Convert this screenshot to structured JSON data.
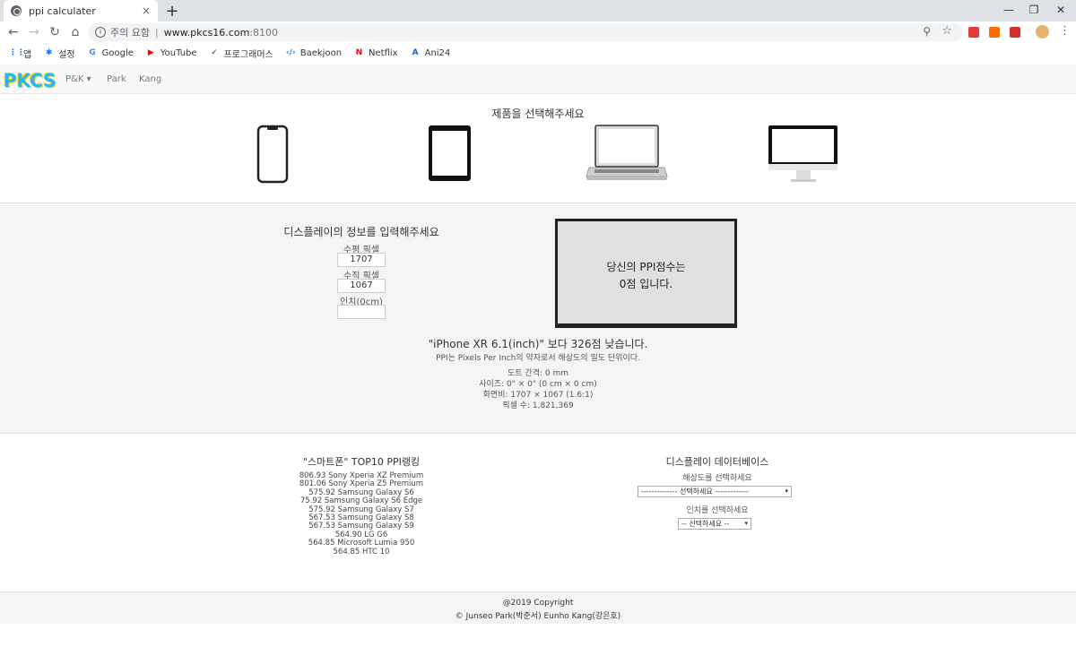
{
  "browser": {
    "tab_title": "ppi calculater",
    "tab_close": "×",
    "new_tab": "+",
    "win_min": "—",
    "win_restore": "❐",
    "win_close": "✕",
    "nav_back": "←",
    "nav_forward": "→",
    "nav_reload": "↻",
    "nav_home": "⌂",
    "address_info": "i",
    "address_warning": "주의 요함",
    "address_sep": "|",
    "address_host": "www.pkcs16.com",
    "address_port": ":8100",
    "zoom_icon": "⚲",
    "star_icon": "☆",
    "menu_icon": "⋮",
    "ext_colors": [
      "#e53935",
      "#ff6d00",
      "#d32f2f"
    ]
  },
  "bookmarks": [
    {
      "label": "앱",
      "icon": "apps-icon",
      "glyph": "⋮⋮",
      "color": "#1a73e8"
    },
    {
      "label": "설정",
      "icon": "gear-icon",
      "glyph": "✱",
      "color": "#1a73e8"
    },
    {
      "label": "Google",
      "icon": "google-icon",
      "glyph": "G",
      "color": "#4285f4"
    },
    {
      "label": "YouTube",
      "icon": "youtube-icon",
      "glyph": "▶",
      "color": "#ff0000"
    },
    {
      "label": "프로그래머스",
      "icon": "programmers-icon",
      "glyph": "✓",
      "color": "#263238"
    },
    {
      "label": "Baekjoon",
      "icon": "code-icon",
      "glyph": "‹/›",
      "color": "#1e88e5"
    },
    {
      "label": "Netflix",
      "icon": "netflix-icon",
      "glyph": "N",
      "color": "#e50914"
    },
    {
      "label": "Ani24",
      "icon": "ani24-icon",
      "glyph": "A",
      "color": "#1565c0"
    }
  ],
  "site": {
    "logo": "PKCS",
    "nav": {
      "pk": "P&K ▾",
      "park": "Park",
      "kang": "Kang"
    }
  },
  "product": {
    "title": "제품을 선택해주세요"
  },
  "form": {
    "title": "디스플레이의 정보를 입력해주세요",
    "h_label": "수평 픽셀",
    "h_value": "1707",
    "v_label": "수직 픽셀",
    "v_value": "1067",
    "inch_label": "인치(0cm)",
    "inch_value": ""
  },
  "result": {
    "line1": "당신의 PPI점수는",
    "line2": "0점 입니다.",
    "compare": "\"iPhone XR 6.1(inch)\" 보다 326점 낮습니다.",
    "definition": "PPI는 Pixels Per Inch의 약자로서 해상도의 밀도 단위이다.",
    "dot_pitch": "도트 간격: 0 mm",
    "size": "사이즈: 0\" × 0\" (0 cm × 0 cm)",
    "aspect": "화면비: 1707 × 1067 (1.6:1)",
    "pixels": "픽셀 수: 1,821,369"
  },
  "ranking": {
    "title": "\"스마트폰\" TOP10 PPI랭킹",
    "items": [
      "806.93 Sony Xperia XZ Premium",
      "801.06 Sony Xperia Z5 Premium",
      "575.92 Samsung Galaxy S6",
      "75.92 Samsung Galaxy S6 Edge",
      "575.92 Samsung Galaxy S7",
      "567.53 Samsung Galaxy S8",
      "567.53 Samsung Galaxy S9",
      "564.90 LG G6",
      "564.85 Microsoft Lumia 950",
      "564.85 HTC 10"
    ]
  },
  "database": {
    "title": "디스플레이 데이터베이스",
    "res_label": "해상도를 선택하세요",
    "res_select": "-------------- 선택하세요 -------------",
    "inch_label": "인치를 선택하세요",
    "inch_select": "-- 선택하세요 --",
    "arrow": "▾"
  },
  "footer": {
    "line1": "@2019 Copyright",
    "line2": "© Junseo Park(박준서) Eunho Kang(강은호)"
  }
}
